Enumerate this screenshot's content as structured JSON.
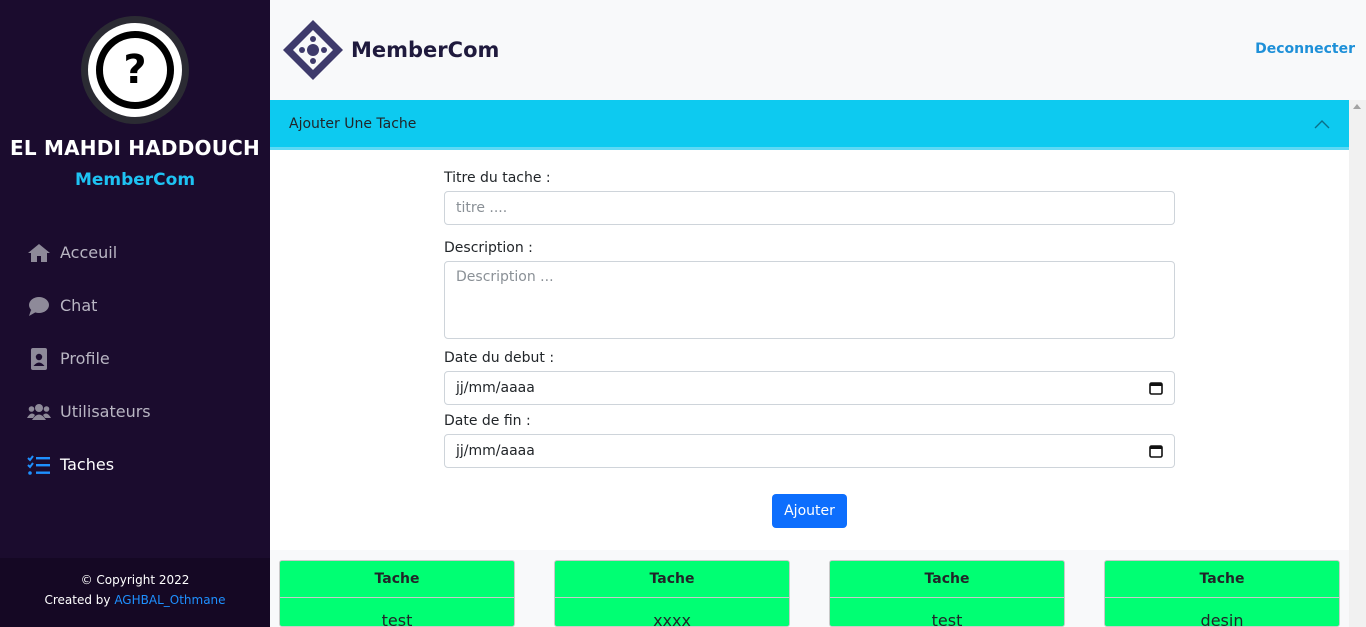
{
  "sidebar": {
    "user_name": "EL MAHDI HADDOUCH",
    "brand": "MemberCom",
    "items": [
      {
        "label": "Acceuil",
        "icon": "home-icon"
      },
      {
        "label": "Chat",
        "icon": "chat-icon"
      },
      {
        "label": "Profile",
        "icon": "profile-icon"
      },
      {
        "label": "Utilisateurs",
        "icon": "users-icon"
      },
      {
        "label": "Taches",
        "icon": "tasks-icon",
        "active": true
      }
    ],
    "footer": {
      "copyright": "© Copyright 2022",
      "created_by": "Created by",
      "author": "AGHBAL_Othmane"
    }
  },
  "header": {
    "logo_text": "MemberCom",
    "logout_label": "Deconnecter"
  },
  "form_card": {
    "title": "Ajouter Une Tache",
    "fields": {
      "title_label": "Titre du tache :",
      "title_placeholder": "titre ....",
      "description_label": "Description :",
      "description_placeholder": "Description ...",
      "start_label": "Date du debut :",
      "start_placeholder": "jj/mm/aaaa",
      "end_label": "Date de fin :",
      "end_placeholder": "jj/mm/aaaa"
    },
    "submit_label": "Ajouter"
  },
  "tasks": [
    {
      "header": "Tache",
      "name": "test"
    },
    {
      "header": "Tache",
      "name": "xxxx"
    },
    {
      "header": "Tache",
      "name": "test"
    },
    {
      "header": "Tache",
      "name": "desin"
    }
  ],
  "colors": {
    "sidebar_bg": "#1b0c2e",
    "accent_cyan": "#0dcaf0",
    "primary_button": "#0d6efd",
    "task_green": "#00ff73",
    "link_blue": "#1e90d8"
  }
}
